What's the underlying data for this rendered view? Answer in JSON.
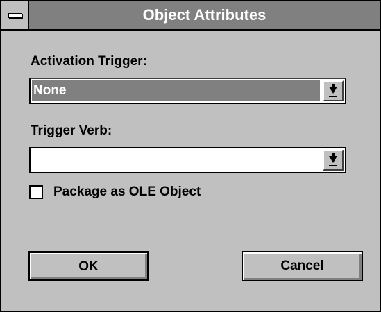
{
  "window": {
    "title": "Object Attributes"
  },
  "activation": {
    "label": "Activation Trigger:",
    "value": "None"
  },
  "trigger_verb": {
    "label": "Trigger Verb:",
    "value": ""
  },
  "package": {
    "label": "Package as OLE Object",
    "checked": false
  },
  "buttons": {
    "ok": "OK",
    "cancel": "Cancel"
  },
  "icons": {
    "system_menu": "system-menu-icon",
    "dropdown": "dropdown-arrow-icon"
  },
  "colors": {
    "face": "#c0c0c0",
    "titlebar": "#808080",
    "selection": "#808080"
  }
}
